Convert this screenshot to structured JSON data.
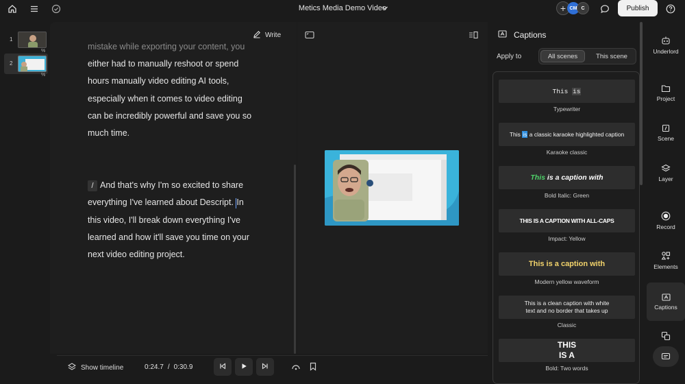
{
  "topbar": {
    "title": "Metics Media Demo Video",
    "avatars": [
      "CM",
      "C"
    ],
    "publish_label": "Publish"
  },
  "scenes": [
    {
      "number": "1"
    },
    {
      "number": "2"
    }
  ],
  "editor": {
    "write_label": "Write",
    "para1_lines": [
      "mistake while exporting your content, you",
      "either had to manually reshoot or spend",
      "hours manually video editing AI tools,",
      "especially when it comes to video editing",
      "can be incredibly powerful and save you so",
      "much time."
    ],
    "slash": "/",
    "para2_line1": "And that's why I'm so excited to share",
    "para2_line2a": "everything I've learned about Descript.",
    "para2_line2b": "In",
    "para2_lines_rest": [
      "this video, I'll break down everything I've",
      "learned and how it'll save you time on your",
      "next video editing project."
    ]
  },
  "player": {
    "show_timeline_label": "Show timeline",
    "current_time": "0:24.7",
    "divider": "/",
    "total_time": "0:30.9"
  },
  "captions": {
    "title": "Captions",
    "apply_to_label": "Apply to",
    "all_scenes_label": "All scenes",
    "this_scene_label": "This scene",
    "styles": [
      {
        "name": "Typewriter",
        "preview_a": "This ",
        "preview_b": "is"
      },
      {
        "name": "Karaoke classic",
        "preview_a": "This ",
        "preview_hl": "is",
        "preview_b": " a classic karaoke highlighted caption"
      },
      {
        "name": "Bold Italic: Green",
        "preview_a": "This",
        "preview_b": " is a caption with"
      },
      {
        "name": "Impact: Yellow",
        "preview_a": "THIS IS A CAPTION WITH ALL-CAPS"
      },
      {
        "name": "Modern yellow waveform",
        "preview_a": "This is a caption with"
      },
      {
        "name": "Classic",
        "preview_a": "This is a clean caption with white",
        "preview_b": "text and no border that takes up"
      },
      {
        "name": "Bold: Two words",
        "preview_a": "THIS",
        "preview_b": "IS A"
      }
    ]
  },
  "rail": [
    {
      "label": "Underlord",
      "icon": "robot-icon"
    },
    {
      "label": "Project",
      "icon": "folder-icon"
    },
    {
      "label": "Scene",
      "icon": "scene-icon"
    },
    {
      "label": "Layer",
      "icon": "layers-icon"
    },
    {
      "label": "Record",
      "icon": "record-icon"
    },
    {
      "label": "Elements",
      "icon": "elements-icon"
    },
    {
      "label": "Captions",
      "icon": "captions-icon"
    }
  ],
  "colors": {
    "accent_blue": "#2f8fe0",
    "green_caption": "#4fd36a",
    "yellow_caption": "#f2d36b"
  }
}
